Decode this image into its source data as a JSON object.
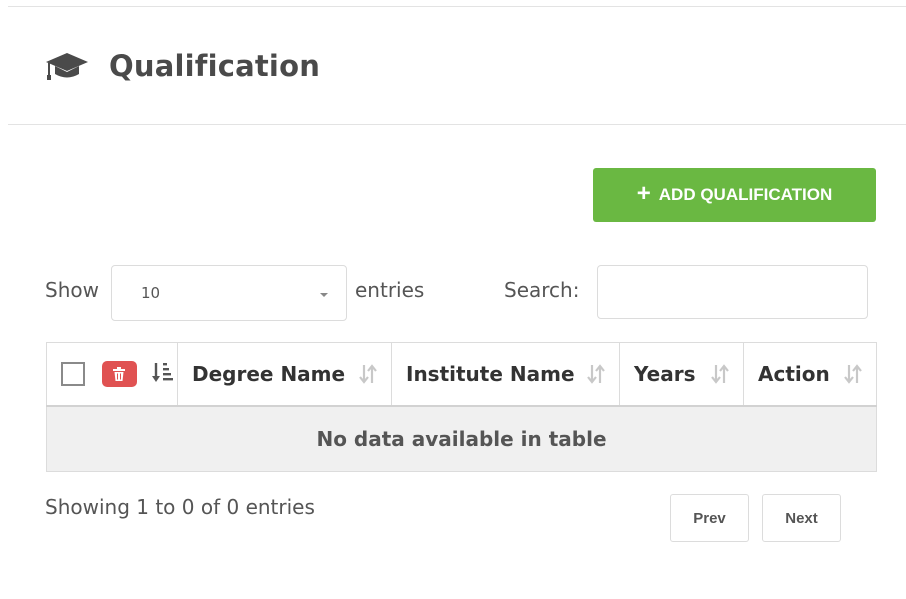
{
  "page": {
    "title": "Qualification",
    "title_icon": "graduation-cap-icon"
  },
  "toolbar": {
    "add_label": "ADD QUALIFICATION",
    "add_icon": "plus-icon",
    "add_color": "#6ab842"
  },
  "length": {
    "show_label": "Show",
    "value": "10",
    "entries_label": "entries"
  },
  "search": {
    "label": "Search:",
    "value": "",
    "placeholder": ""
  },
  "table": {
    "columns": [
      "Degree Name",
      "Institute Name",
      "Years",
      "Action"
    ],
    "empty_message": "No data available in table",
    "delete_color": "#e05252"
  },
  "footer": {
    "info": "Showing 1 to 0 of 0 entries",
    "prev_label": "Prev",
    "next_label": "Next"
  }
}
